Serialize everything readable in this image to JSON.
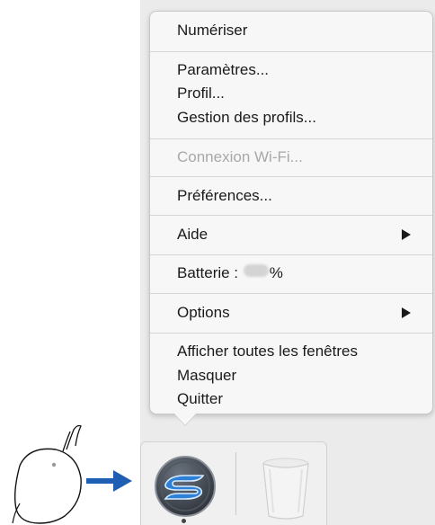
{
  "menu": {
    "items": [
      {
        "label": "Numériser"
      },
      {
        "label": "Paramètres..."
      },
      {
        "label": "Profil..."
      },
      {
        "label": "Gestion des profils..."
      },
      {
        "label": "Connexion Wi-Fi...",
        "disabled": true
      },
      {
        "label": "Préférences..."
      },
      {
        "label": "Aide",
        "submenu": true
      },
      {
        "label_prefix": "Batterie : ",
        "label_value": "100",
        "label_suffix": "%"
      },
      {
        "label": "Options",
        "submenu": true
      },
      {
        "label": "Afficher toutes les fenêtres"
      },
      {
        "label": "Masquer"
      },
      {
        "label": "Quitter"
      }
    ]
  },
  "dock": {
    "app_icon": "scansnap-s-icon",
    "trash_icon": "trash-icon"
  },
  "illustration": {
    "mouse_icon": "mouse-icon",
    "arrow_icon": "arrow-right-icon",
    "arrow_color": "#1f5fb3"
  }
}
